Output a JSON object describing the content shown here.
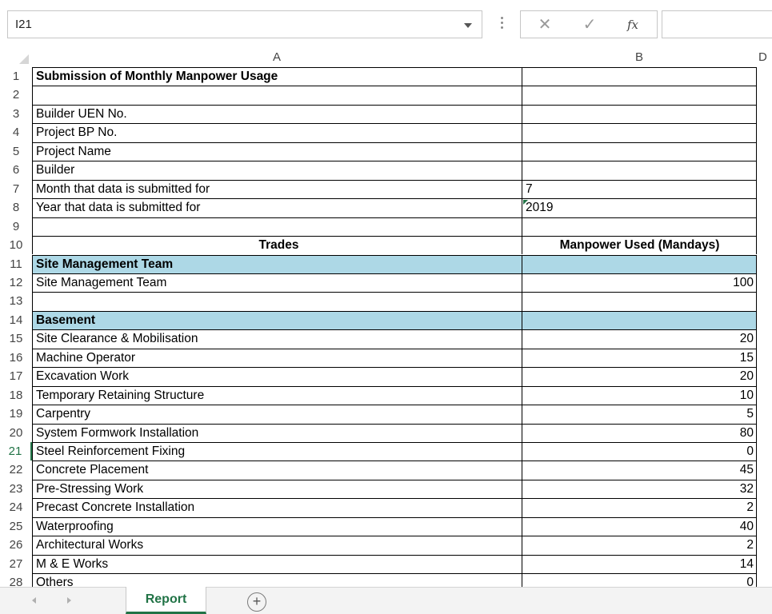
{
  "formula_bar": {
    "name_box": "I21",
    "cancel_icon": "✕",
    "enter_icon": "✓",
    "function_label": "fx",
    "formula_value": ""
  },
  "columns": [
    "A",
    "B",
    "D"
  ],
  "rows": [
    {
      "num": "1",
      "a": "Submission of Monthly Manpower Usage",
      "b": ""
    },
    {
      "num": "2",
      "a": "",
      "b": ""
    },
    {
      "num": "3",
      "a": "Builder UEN No.",
      "b": ""
    },
    {
      "num": "4",
      "a": "Project BP No.",
      "b": ""
    },
    {
      "num": "5",
      "a": "Project Name",
      "b": ""
    },
    {
      "num": "6",
      "a": "Builder",
      "b": ""
    },
    {
      "num": "7",
      "a": "Month that data is submitted for",
      "b": "7"
    },
    {
      "num": "8",
      "a": "Year that data is submitted for",
      "b": "2019"
    },
    {
      "num": "9",
      "a": "",
      "b": ""
    },
    {
      "num": "10",
      "a": "Trades",
      "b": "Manpower Used (Mandays)"
    },
    {
      "num": "11",
      "a": "Site Management Team",
      "b": ""
    },
    {
      "num": "12",
      "a": "Site Management Team",
      "b": "100"
    },
    {
      "num": "13",
      "a": "",
      "b": ""
    },
    {
      "num": "14",
      "a": "Basement",
      "b": ""
    },
    {
      "num": "15",
      "a": "Site Clearance & Mobilisation",
      "b": "20"
    },
    {
      "num": "16",
      "a": "Machine Operator",
      "b": "15"
    },
    {
      "num": "17",
      "a": "Excavation Work",
      "b": "20"
    },
    {
      "num": "18",
      "a": "Temporary Retaining Structure",
      "b": "10"
    },
    {
      "num": "19",
      "a": "Carpentry",
      "b": "5"
    },
    {
      "num": "20",
      "a": "System Formwork Installation",
      "b": "80"
    },
    {
      "num": "21",
      "a": "Steel Reinforcement Fixing",
      "b": "0"
    },
    {
      "num": "22",
      "a": "Concrete Placement",
      "b": "45"
    },
    {
      "num": "23",
      "a": "Pre-Stressing Work",
      "b": "32"
    },
    {
      "num": "24",
      "a": "Precast Concrete Installation",
      "b": "2"
    },
    {
      "num": "25",
      "a": "Waterproofing",
      "b": "40"
    },
    {
      "num": "26",
      "a": "Architectural Works",
      "b": "2"
    },
    {
      "num": "27",
      "a": "M & E Works",
      "b": "14"
    },
    {
      "num": "28",
      "a": "Others",
      "b": "0"
    }
  ],
  "sheet_tabs": {
    "active": "Report",
    "add_symbol": "+"
  },
  "colors": {
    "section_fill": "#add8e6",
    "accent": "#217346"
  }
}
